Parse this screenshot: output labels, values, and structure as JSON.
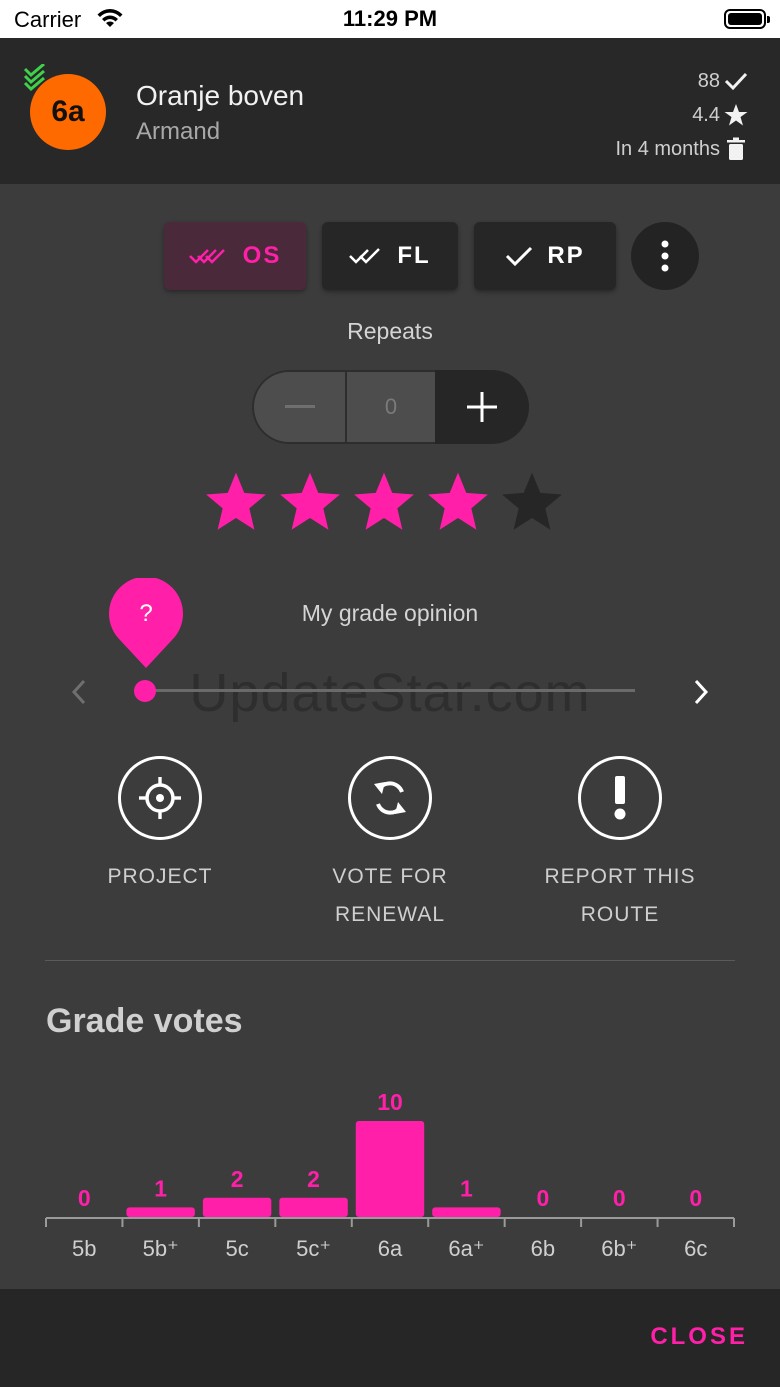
{
  "status_bar": {
    "carrier": "Carrier",
    "time": "11:29 PM"
  },
  "header": {
    "grade": "6a",
    "route_name": "Oranje boven",
    "setter": "Armand",
    "ascents": "88",
    "rating": "4.4",
    "removal": "In 4 months",
    "grade_color": "#ff6a00"
  },
  "tick_types": [
    {
      "label": "OS",
      "icon": "triple-check-icon",
      "selected": true
    },
    {
      "label": "FL",
      "icon": "double-check-icon",
      "selected": false
    },
    {
      "label": "RP",
      "icon": "check-icon",
      "selected": false
    }
  ],
  "repeats": {
    "label": "Repeats",
    "value": "0"
  },
  "rating": {
    "value": 4,
    "max": 5
  },
  "grade_opinion": {
    "label": "My grade opinion",
    "pin_text": "?"
  },
  "watermark": "UpdateStar.com",
  "actions": [
    {
      "label_line1": "PROJECT",
      "label_line2": "",
      "icon": "crosshair-icon"
    },
    {
      "label_line1": "VOTE FOR",
      "label_line2": "RENEWAL",
      "icon": "refresh-icon"
    },
    {
      "label_line1": "REPORT THIS",
      "label_line2": "ROUTE",
      "icon": "exclamation-icon"
    }
  ],
  "grade_votes": {
    "title": "Grade votes"
  },
  "chart_data": {
    "type": "bar",
    "categories": [
      "5b",
      "5b⁺",
      "5c",
      "5c⁺",
      "6a",
      "6a⁺",
      "6b",
      "6b⁺",
      "6c"
    ],
    "values": [
      0,
      1,
      2,
      2,
      10,
      1,
      0,
      0,
      0
    ],
    "title": "Grade votes",
    "xlabel": "",
    "ylabel": "",
    "ylim": [
      0,
      10
    ],
    "bar_color": "#ff1fa8",
    "grid": false
  },
  "footer": {
    "close_label": "CLOSE"
  },
  "colors": {
    "accent": "#ff1fa8",
    "background": "#3c3c3c",
    "header": "#282828"
  }
}
